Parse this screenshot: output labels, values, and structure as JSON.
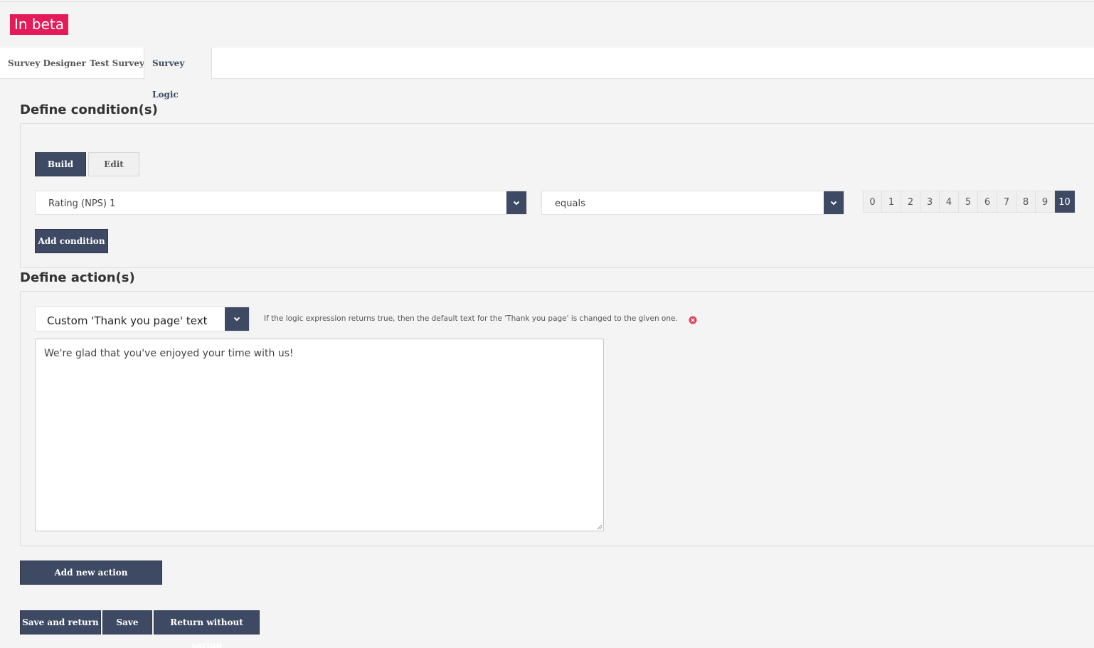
{
  "badge": {
    "label": "In beta"
  },
  "tabs": [
    {
      "label": "Survey Designer"
    },
    {
      "label": "Test Survey"
    },
    {
      "label": "Survey Logic"
    }
  ],
  "conditions": {
    "title": "Define condition(s)",
    "build_label": "Build",
    "edit_label": "Edit",
    "question_value": "Rating (NPS) 1",
    "operator_value": "equals",
    "rating_values": [
      "0",
      "1",
      "2",
      "3",
      "4",
      "5",
      "6",
      "7",
      "8",
      "9",
      "10"
    ],
    "selected_value": "10",
    "add_label": "Add condition"
  },
  "actions": {
    "title": "Define action(s)",
    "action_value": "Custom 'Thank you page' text",
    "hint": "If the logic expression returns true, then the default text for the 'Thank you page' is changed to the given one.",
    "text": "We're glad that you've enjoyed your time with us!",
    "add_label": "Add new action"
  },
  "footer": {
    "save_return_label": "Save and return",
    "save_label": "Save",
    "return_label": "Return without saving"
  },
  "colors": {
    "accent": "#3e4a64",
    "badge": "#e31b5a",
    "remove": "#e0425a"
  }
}
